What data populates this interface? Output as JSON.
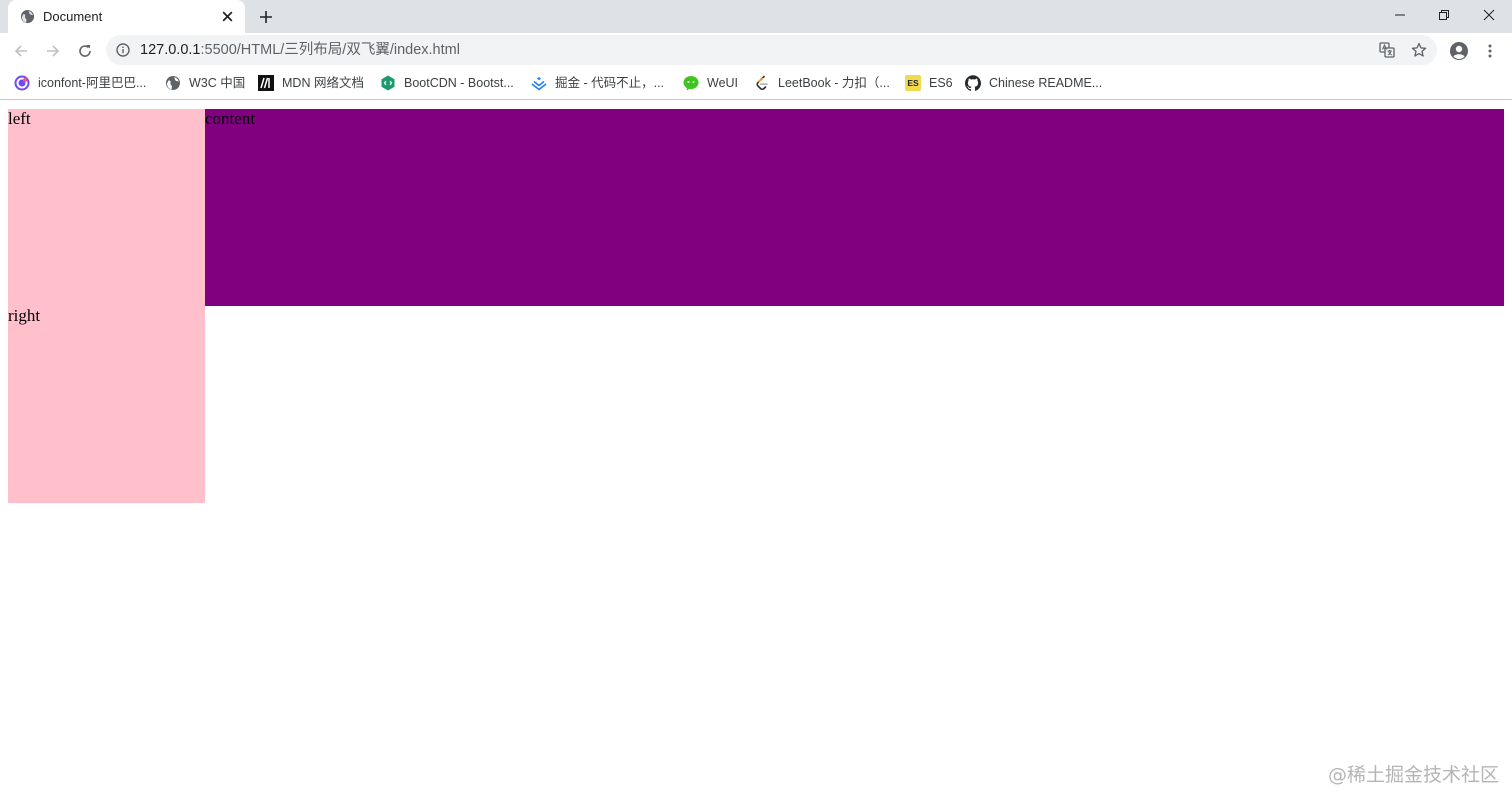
{
  "tab": {
    "title": "Document",
    "favicon": "globe-icon",
    "close": "close-icon"
  },
  "toolbar": {
    "url_host": "127.0.0.1",
    "url_rest": ":5500/HTML/三列布局/双飞翼/index.html"
  },
  "bookmarks": [
    {
      "label": "iconfont-阿里巴巴...",
      "icon": "iconfont-icon"
    },
    {
      "label": "W3C 中国",
      "icon": "globe-icon"
    },
    {
      "label": "MDN 网络文档",
      "icon": "mdn-icon"
    },
    {
      "label": "BootCDN - Bootst...",
      "icon": "bootcdn-icon"
    },
    {
      "label": "掘金 - 代码不止，...",
      "icon": "juejin-icon"
    },
    {
      "label": "WeUI",
      "icon": "wechat-icon"
    },
    {
      "label": "LeetBook - 力扣（...",
      "icon": "leetcode-icon"
    },
    {
      "label": "ES6",
      "icon": "es6-icon",
      "badge": "ES"
    },
    {
      "label": "Chinese README...",
      "icon": "github-icon"
    }
  ],
  "page": {
    "left": "left",
    "content": "content",
    "right": "right"
  },
  "colors": {
    "side_box": "#ffc0cb",
    "content_box": "#800080"
  },
  "watermark": "@稀土掘金技术社区"
}
